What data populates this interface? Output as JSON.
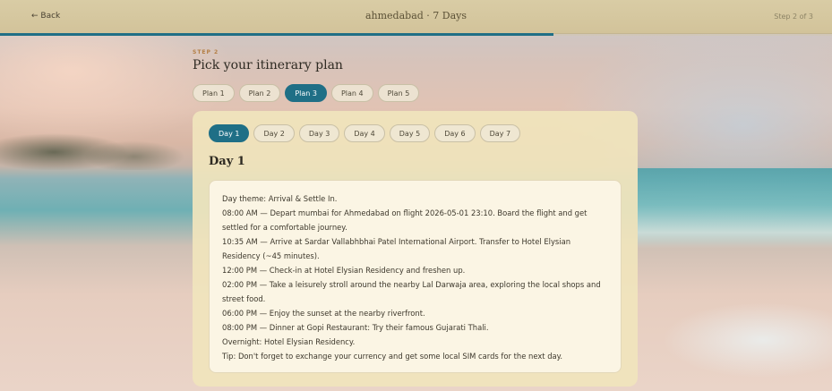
{
  "header": {
    "back_label": "← Back",
    "title": "ahmedabad · 7 Days",
    "step_indicator": "Step 2 of 3",
    "progress_fraction": 0.665,
    "accent_color": "#1f6f86"
  },
  "main": {
    "step_label": "STEP 2",
    "title": "Pick your itinerary plan",
    "plans": [
      "Plan 1",
      "Plan 2",
      "Plan 3",
      "Plan 4",
      "Plan 5"
    ],
    "selected_plan": "Plan 3",
    "days": [
      "Day 1",
      "Day 2",
      "Day 3",
      "Day 4",
      "Day 5",
      "Day 6",
      "Day 7"
    ],
    "selected_day": "Day 1",
    "day_heading": "Day 1",
    "itinerary_lines": [
      "Day theme: Arrival & Settle In.",
      "08:00 AM — Depart mumbai for Ahmedabad on flight 2026-05-01 23:10. Board the flight and get settled for a comfortable journey.",
      "10:35 AM — Arrive at Sardar Vallabhbhai Patel International Airport. Transfer to Hotel Elysian Residency (~45 minutes).",
      "12:00 PM — Check-in at Hotel Elysian Residency and freshen up.",
      "02:00 PM — Take a leisurely stroll around the nearby Lal Darwaja area, exploring the local shops and street food.",
      "06:00 PM — Enjoy the sunset at the nearby riverfront.",
      "08:00 PM — Dinner at Gopi Restaurant: Try their famous Gujarati Thali.",
      "Overnight: Hotel Elysian Residency.",
      "Tip: Don't forget to exchange your currency and get some local SIM cards for the next day."
    ]
  }
}
